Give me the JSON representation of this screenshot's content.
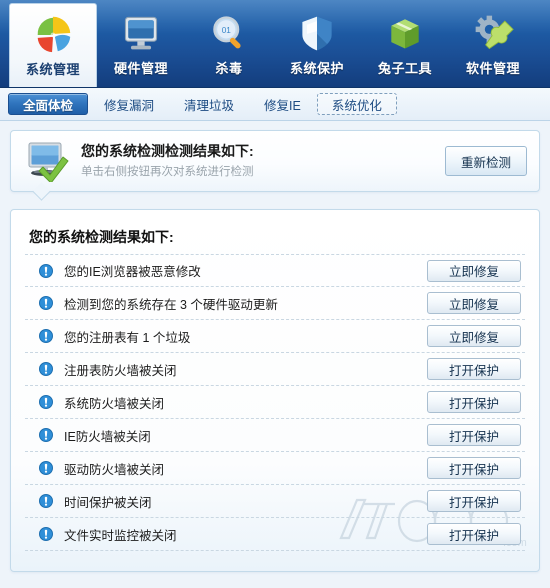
{
  "colors": {
    "toolbar_top": "#2b6fb8",
    "toolbar_bottom": "#133d7d",
    "accent_blue": "#2f74bd",
    "panel_border": "#c3daea",
    "warn_icon": "#2f8fd8",
    "page_bg": "#eef4fa"
  },
  "toolbar": {
    "items": [
      {
        "label": "系统管理",
        "icon": "pie-chart-icon",
        "active": true
      },
      {
        "label": "硬件管理",
        "icon": "monitor-icon",
        "active": false
      },
      {
        "label": "杀毒",
        "icon": "magnifier-icon",
        "active": false
      },
      {
        "label": "系统保护",
        "icon": "shield-icon",
        "active": false
      },
      {
        "label": "兔子工具",
        "icon": "green-box-icon",
        "active": false
      },
      {
        "label": "软件管理",
        "icon": "gear-wrench-icon",
        "active": false
      }
    ]
  },
  "tabs": [
    {
      "label": "全面体检",
      "state": "active"
    },
    {
      "label": "修复漏洞",
      "state": "normal"
    },
    {
      "label": "清理垃圾",
      "state": "normal"
    },
    {
      "label": "修复IE",
      "state": "normal"
    },
    {
      "label": "系统优化",
      "state": "focused"
    }
  ],
  "summary": {
    "icon": "monitor-check-icon",
    "title": "您的系统检测检测结果如下:",
    "subtitle": "单击右侧按钮再次对系统进行检测",
    "rescan_label": "重新检测"
  },
  "results": {
    "heading": "您的系统检测结果如下:",
    "rows": [
      {
        "icon": "warning-icon",
        "text": "您的IE浏览器被恶意修改",
        "action": "立即修复"
      },
      {
        "icon": "warning-icon",
        "text": "检测到您的系统存在 3 个硬件驱动更新",
        "action": "立即修复"
      },
      {
        "icon": "warning-icon",
        "text": "您的注册表有 1 个垃圾",
        "action": "立即修复"
      },
      {
        "icon": "warning-icon",
        "text": "注册表防火墙被关闭",
        "action": "打开保护"
      },
      {
        "icon": "warning-icon",
        "text": "系统防火墙被关闭",
        "action": "打开保护"
      },
      {
        "icon": "warning-icon",
        "text": "IE防火墙被关闭",
        "action": "打开保护"
      },
      {
        "icon": "warning-icon",
        "text": "驱动防火墙被关闭",
        "action": "打开保护"
      },
      {
        "icon": "warning-icon",
        "text": "时间保护被关闭",
        "action": "打开保护"
      },
      {
        "icon": "warning-icon",
        "text": "文件实时监控被关闭",
        "action": "打开保护"
      }
    ]
  },
  "watermark": {
    "text": "IT168",
    "suffix": ".com"
  }
}
